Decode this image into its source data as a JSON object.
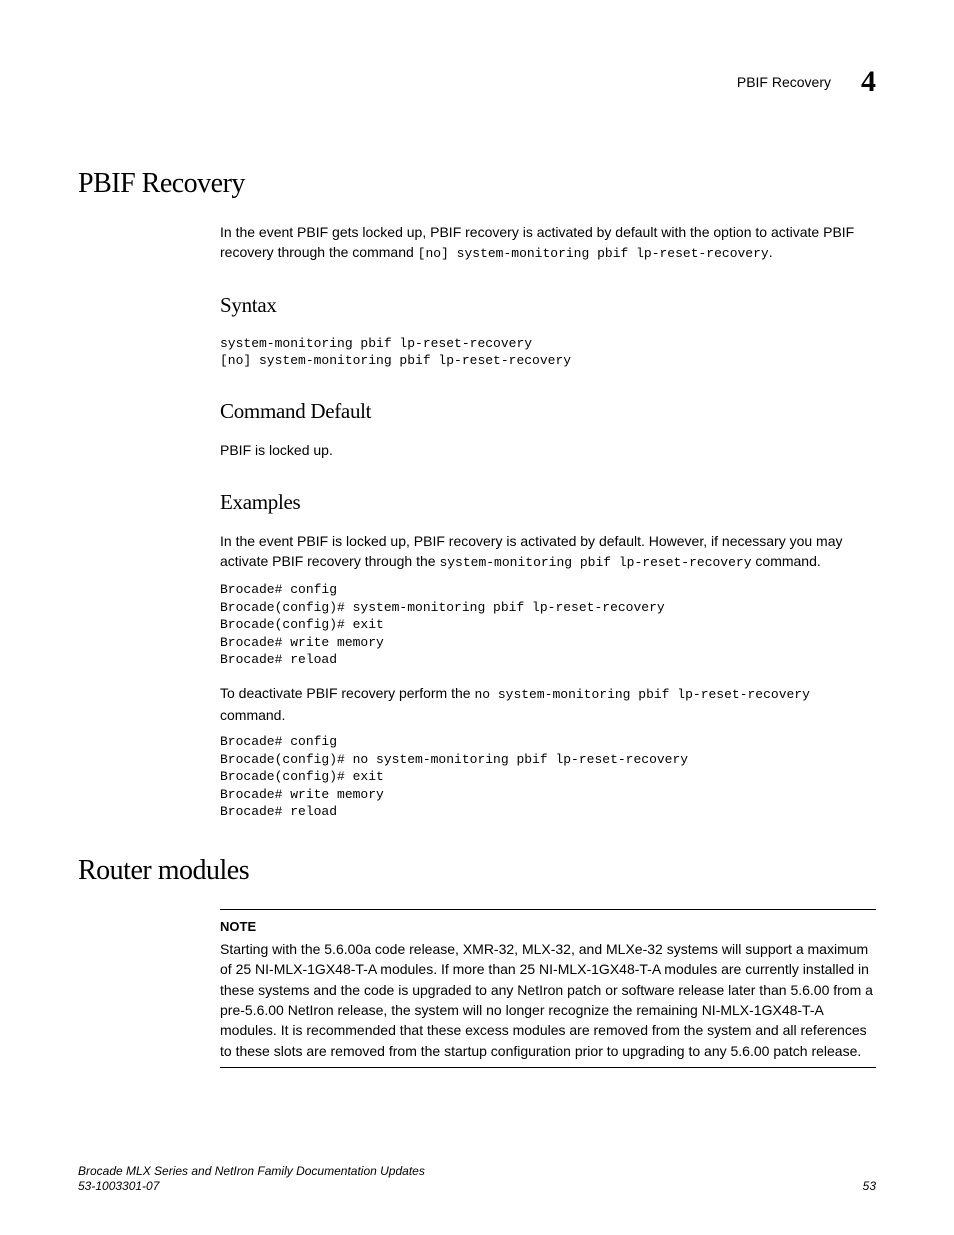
{
  "header": {
    "running_title": "PBIF Recovery",
    "chapter_number": "4"
  },
  "h1_pbif": "PBIF Recovery",
  "intro_leading": "In the event PBIF gets locked up, PBIF recovery is activated by default with the option to activate PBIF recovery through the command ",
  "intro_code": "[no] system-monitoring pbif lp-reset-recovery",
  "intro_trailing": ".",
  "h2_syntax": "Syntax",
  "syntax_block": "system-monitoring pbif lp-reset-recovery\n[no] system-monitoring pbif lp-reset-recovery",
  "h2_cmd_default": "Command Default",
  "cmd_default_text": "PBIF is locked up.",
  "h2_examples": "Examples",
  "examples_p1_leading": "In the event PBIF is locked up, PBIF recovery is activated by default. However, if necessary you may activate PBIF recovery through the ",
  "examples_p1_code": "system-monitoring pbif lp-reset-recovery",
  "examples_p1_trailing": " command.",
  "examples_block1": "Brocade# config\nBrocade(config)# system-monitoring pbif lp-reset-recovery\nBrocade(config)# exit\nBrocade# write memory\nBrocade# reload",
  "examples_p2_leading": "To deactivate PBIF recovery perform the ",
  "examples_p2_code": "no system-monitoring pbif lp-reset-recovery",
  "examples_p2_trailing": " command.",
  "examples_block2": "Brocade# config\nBrocade(config)# no system-monitoring pbif lp-reset-recovery\nBrocade(config)# exit\nBrocade# write memory\nBrocade# reload",
  "h1_router": "Router modules",
  "note_label": "NOTE",
  "note_body": "Starting with the 5.6.00a code release, XMR-32, MLX-32, and MLXe-32 systems will support a maximum of 25 NI-MLX-1GX48-T-A modules. If more than 25 NI-MLX-1GX48-T-A modules are currently installed in these systems and the code is upgraded to any NetIron patch or software release later than 5.6.00 from a pre-5.6.00 NetIron release, the system will no longer recognize the remaining NI-MLX-1GX48-T-A modules. It is recommended that these excess modules are removed from the system and all references to these slots are removed from the startup configuration prior to upgrading to any 5.6.00 patch release.",
  "footer": {
    "doc_title": "Brocade MLX Series and NetIron Family Documentation Updates",
    "doc_number": "53-1003301-07",
    "page_number": "53"
  }
}
